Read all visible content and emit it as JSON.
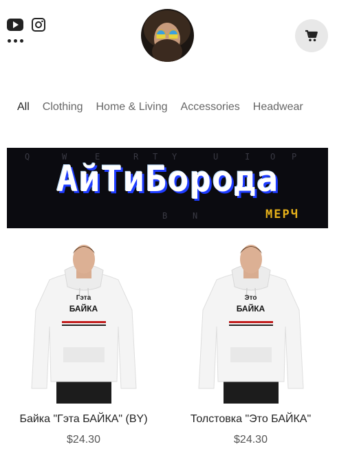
{
  "nav": {
    "categories": [
      "All",
      "Clothing",
      "Home & Living",
      "Accessories",
      "Headwear"
    ]
  },
  "banner": {
    "title": "АйТиБорода",
    "subtitle": "МЕРЧ",
    "keys": [
      "Q",
      "W",
      "E",
      "R",
      "T",
      "Y",
      "U",
      "I",
      "O",
      "P",
      "B",
      "N"
    ]
  },
  "products": [
    {
      "name": "Байка \"Гэта БАЙКА\" (BY)",
      "price": "$24.30",
      "print_line1": "Гэта",
      "print_line2": "БАЙКА"
    },
    {
      "name": "Толстовка \"Это БАЙКА\"",
      "price": "$24.30",
      "print_line1": "Это",
      "print_line2": "БАЙКА"
    }
  ],
  "colors": {
    "banner_bg": "#0b0b10",
    "merch_accent": "#e8b21a",
    "cart_bg": "#e8e8e8"
  },
  "icons": {
    "youtube": "youtube-icon",
    "instagram": "instagram-icon",
    "more": "more-dots-icon",
    "cart": "cart-icon"
  }
}
